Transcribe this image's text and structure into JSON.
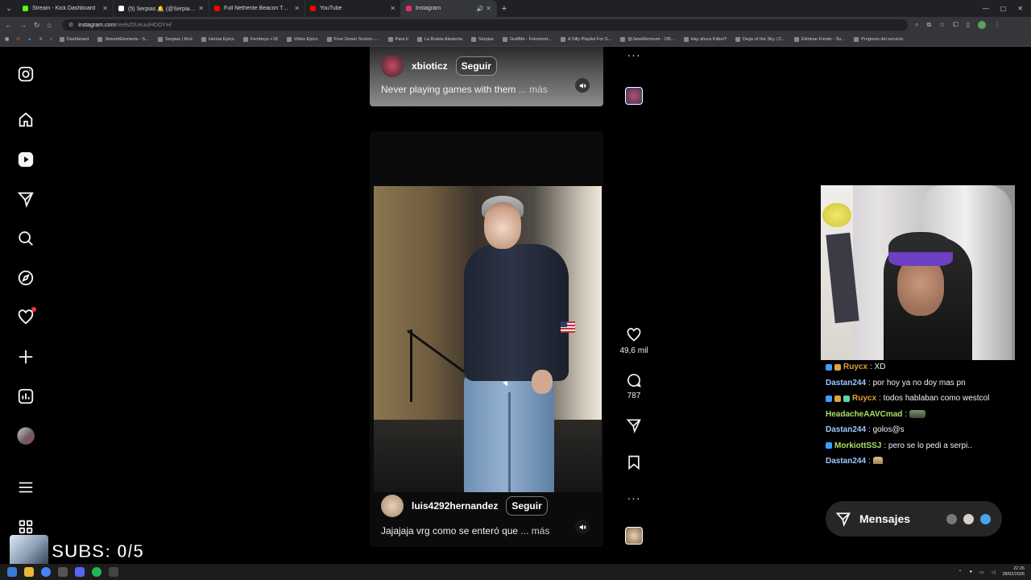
{
  "browser": {
    "tabs": [
      {
        "title": "Stream - Kick Dashboard",
        "color": "#53fc18",
        "active": false
      },
      {
        "title": "(5) Serpias 🔔 (@Serpias) / X",
        "color": "#ffffff",
        "active": false
      },
      {
        "title": "Full Netherite Beacon TAS (4 m",
        "color": "#ff0000",
        "active": false
      },
      {
        "title": "YouTube",
        "color": "#ff0000",
        "active": false
      },
      {
        "title": "Instagram",
        "color": "#e1306c",
        "active": true
      }
    ],
    "url": "instagram.com",
    "url_path": "/reels/DUeuuIHDOYH/",
    "bookmarks": [
      "Dashboard",
      "StreamElements - S...",
      "Serpias | Kick",
      "Hentai Epico",
      "Femboys +18",
      "Video Epico",
      "Free Green Screen -...",
      "Para ti",
      "La Ruleta Aleatoria",
      "Serpias",
      "GrafMe - Fotomont...",
      "A Silly Playlist For S...",
      "@JaneRemover - OB...",
      "Hay ahora Kitboi?",
      "Dege of the Sky | C...",
      "Eliminar Fondo - Su...",
      "Progreso del servicio"
    ]
  },
  "sidebar": {
    "items": [
      {
        "name": "instagram-logo-icon"
      },
      {
        "name": "home-icon"
      },
      {
        "name": "reels-icon"
      },
      {
        "name": "direct-messages-icon"
      },
      {
        "name": "search-icon"
      },
      {
        "name": "explore-icon"
      },
      {
        "name": "notifications-heart-icon"
      },
      {
        "name": "create-plus-icon"
      },
      {
        "name": "dashboard-icon"
      },
      {
        "name": "profile-avatar"
      },
      {
        "name": "more-menu-icon"
      },
      {
        "name": "also-from-meta-icon"
      }
    ]
  },
  "reel_prev": {
    "username": "xbioticz",
    "follow_label": "Seguir",
    "caption": "Never playing games with them",
    "more_label": "... más"
  },
  "reel_current": {
    "username": "luis4292hernandez",
    "follow_label": "Seguir",
    "caption": "Jajajaja vrg como se enteró que",
    "more_label": "... más",
    "likes": "49,6 mil",
    "comments": "787"
  },
  "chat": {
    "lines": [
      {
        "user": "Ruycx",
        "text": ": XD",
        "color": "#e3a13c",
        "badges": 2
      },
      {
        "user": "Dastan244",
        "text": ": por hoy ya no doy mas pn",
        "color": "#9ec9ff",
        "badges": 0
      },
      {
        "user": "Ruycx",
        "text": ": todos hablaban como westcol",
        "color": "#e3a13c",
        "badges": 3
      },
      {
        "user": "HeadacheAAVCmad",
        "text": ":",
        "color": "#a8e063",
        "badges": 0,
        "emote": "tank"
      },
      {
        "user": "Dastan244",
        "text": ": golos@s",
        "color": "#9ec9ff",
        "badges": 0
      },
      {
        "user": "MorkiottSSJ",
        "text": ": pero se lo pedi a serpi..",
        "color": "#a8e063",
        "badges": 1
      },
      {
        "user": "Dastan244",
        "text": ":",
        "color": "#9ec9ff",
        "badges": 0,
        "emote": "cat"
      }
    ]
  },
  "messages_button": {
    "label": "Mensajes"
  },
  "overlay": {
    "subs_text": "SUBS: 0/5"
  },
  "taskbar": {
    "time": "22:26",
    "date": "28/02/2026"
  }
}
